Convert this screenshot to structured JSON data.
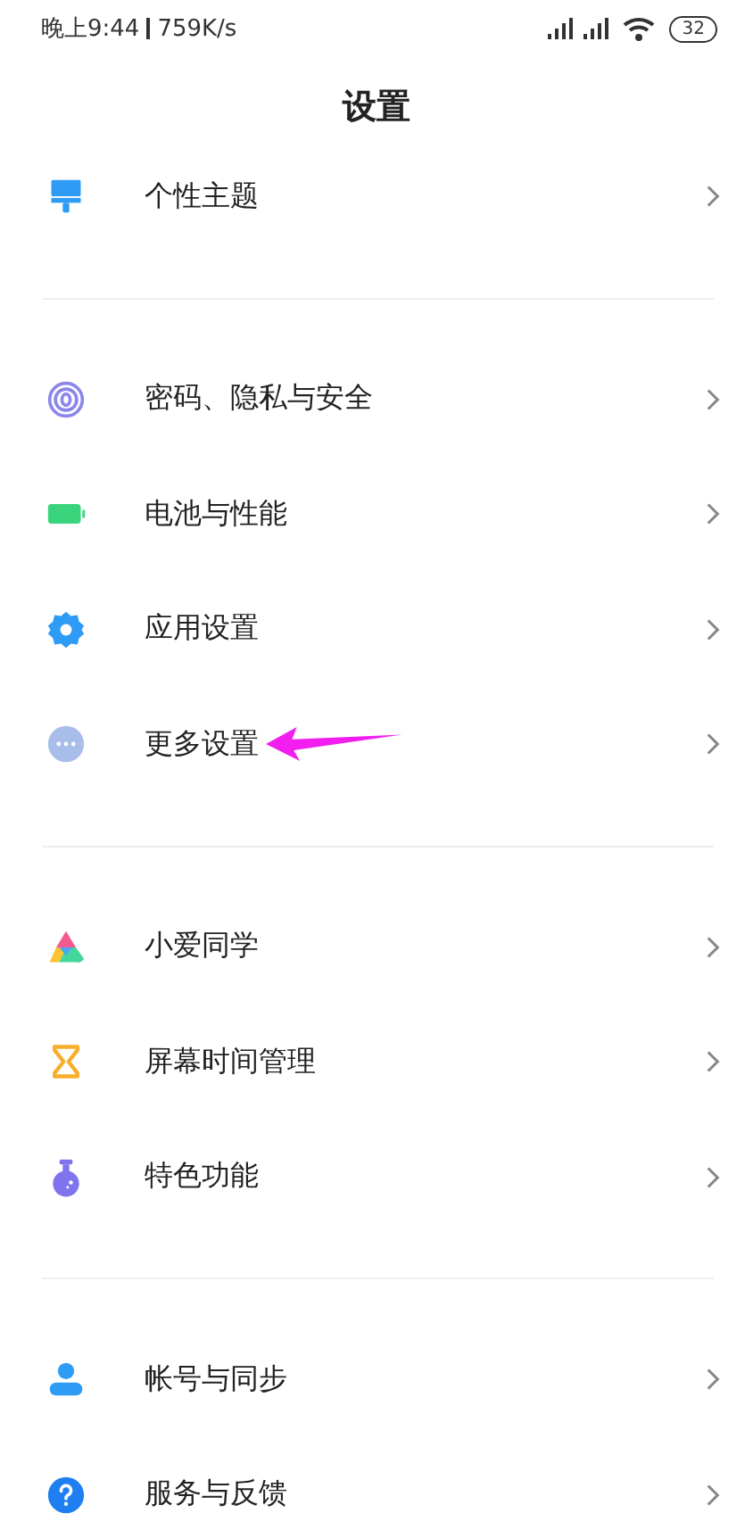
{
  "status_bar": {
    "time": "晚上9:44",
    "speed": "759K/s",
    "battery": "32"
  },
  "title": "设置",
  "groups": [
    {
      "items": [
        {
          "kind": "brush",
          "label": "个性主题",
          "annotated": false
        }
      ]
    },
    {
      "items": [
        {
          "kind": "fingerprint",
          "label": "密码、隐私与安全",
          "annotated": false
        },
        {
          "kind": "battery",
          "label": "电池与性能",
          "annotated": false
        },
        {
          "kind": "gear",
          "label": "应用设置",
          "annotated": false
        },
        {
          "kind": "more",
          "label": "更多设置",
          "annotated": true
        }
      ]
    },
    {
      "items": [
        {
          "kind": "assistant",
          "label": "小爱同学",
          "annotated": false
        },
        {
          "kind": "hourglass",
          "label": "屏幕时间管理",
          "annotated": false
        },
        {
          "kind": "flask",
          "label": "特色功能",
          "annotated": false
        }
      ]
    },
    {
      "items": [
        {
          "kind": "person",
          "label": "帐号与同步",
          "annotated": false
        },
        {
          "kind": "help",
          "label": "服务与反馈",
          "annotated": false
        }
      ]
    }
  ]
}
